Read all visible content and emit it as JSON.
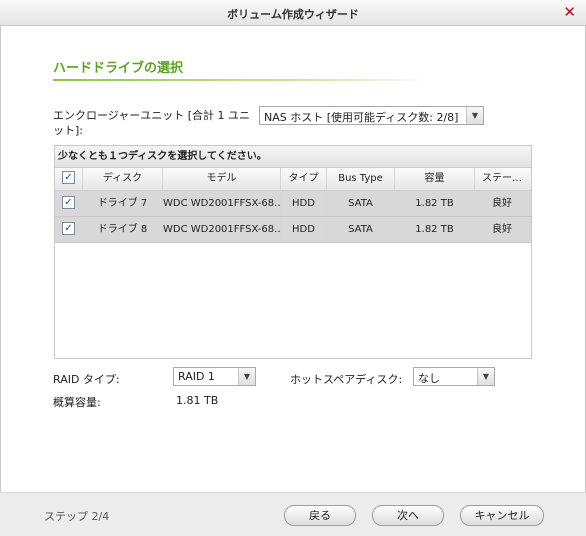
{
  "window": {
    "title": "ボリューム作成ウィザード",
    "close_glyph": "✕"
  },
  "section": {
    "title": "ハードドライブの選択"
  },
  "enclosure": {
    "label": "エンクロージャーユニット [合計 1 ユニット]:",
    "selected": "NAS ホスト [使用可能ディスク数: 2/8]"
  },
  "disk_table": {
    "caption": "少なくとも１つディスクを選択してください。",
    "columns": [
      "ディスク",
      "モデル",
      "タイプ",
      "Bus Type",
      "容量",
      "ステー…"
    ],
    "rows": [
      {
        "checked": true,
        "disk": "ドライブ 7",
        "model": "WDC WD2001FFSX-68…",
        "type": "HDD",
        "bus": "SATA",
        "capacity": "1.82 TB",
        "status": "良好"
      },
      {
        "checked": true,
        "disk": "ドライブ 8",
        "model": "WDC WD2001FFSX-68…",
        "type": "HDD",
        "bus": "SATA",
        "capacity": "1.82 TB",
        "status": "良好"
      }
    ],
    "select_all_checked": true
  },
  "raid": {
    "label": "RAID タイプ:",
    "selected": "RAID 1"
  },
  "hot_spare": {
    "label": "ホットスペアディスク:",
    "selected": "なし"
  },
  "capacity": {
    "label": "概算容量:",
    "value": "1.81 TB"
  },
  "footer": {
    "step": "ステップ 2/4",
    "back_label": "戻る",
    "next_label": "次へ",
    "cancel_label": "キャンセル"
  }
}
